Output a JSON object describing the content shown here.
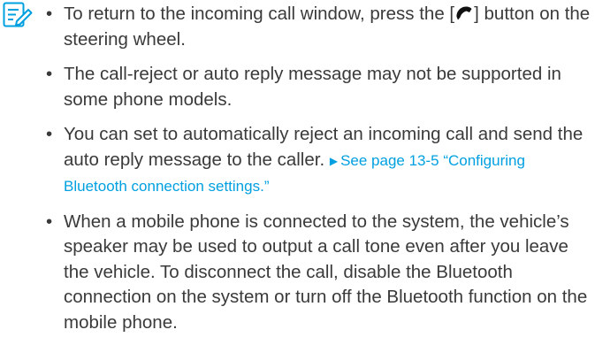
{
  "note": {
    "icon": "note-pencil-icon",
    "accent_color": "#00a0e0",
    "bullet": "•",
    "items": [
      {
        "text_before": "To return to the incoming call window, press the [",
        "inline_icon": "phone-handset-icon",
        "text_after": "] button on the steering wheel."
      },
      {
        "text": "The call-reject or auto reply message may not be supported in some phone models."
      },
      {
        "text": "You can set to automatically reject an incoming call and send the auto reply message to the caller. ",
        "link_arrow": "▶",
        "link_text": "See page 13-5 “Configuring Bluetooth connection settings.”"
      },
      {
        "text": "When a mobile phone is connected to the system, the vehicle’s speaker may be used to output a call tone even after you leave the vehicle. To disconnect the call, disable the Bluetooth connection on the system or turn off the Bluetooth function on the mobile phone."
      }
    ]
  }
}
